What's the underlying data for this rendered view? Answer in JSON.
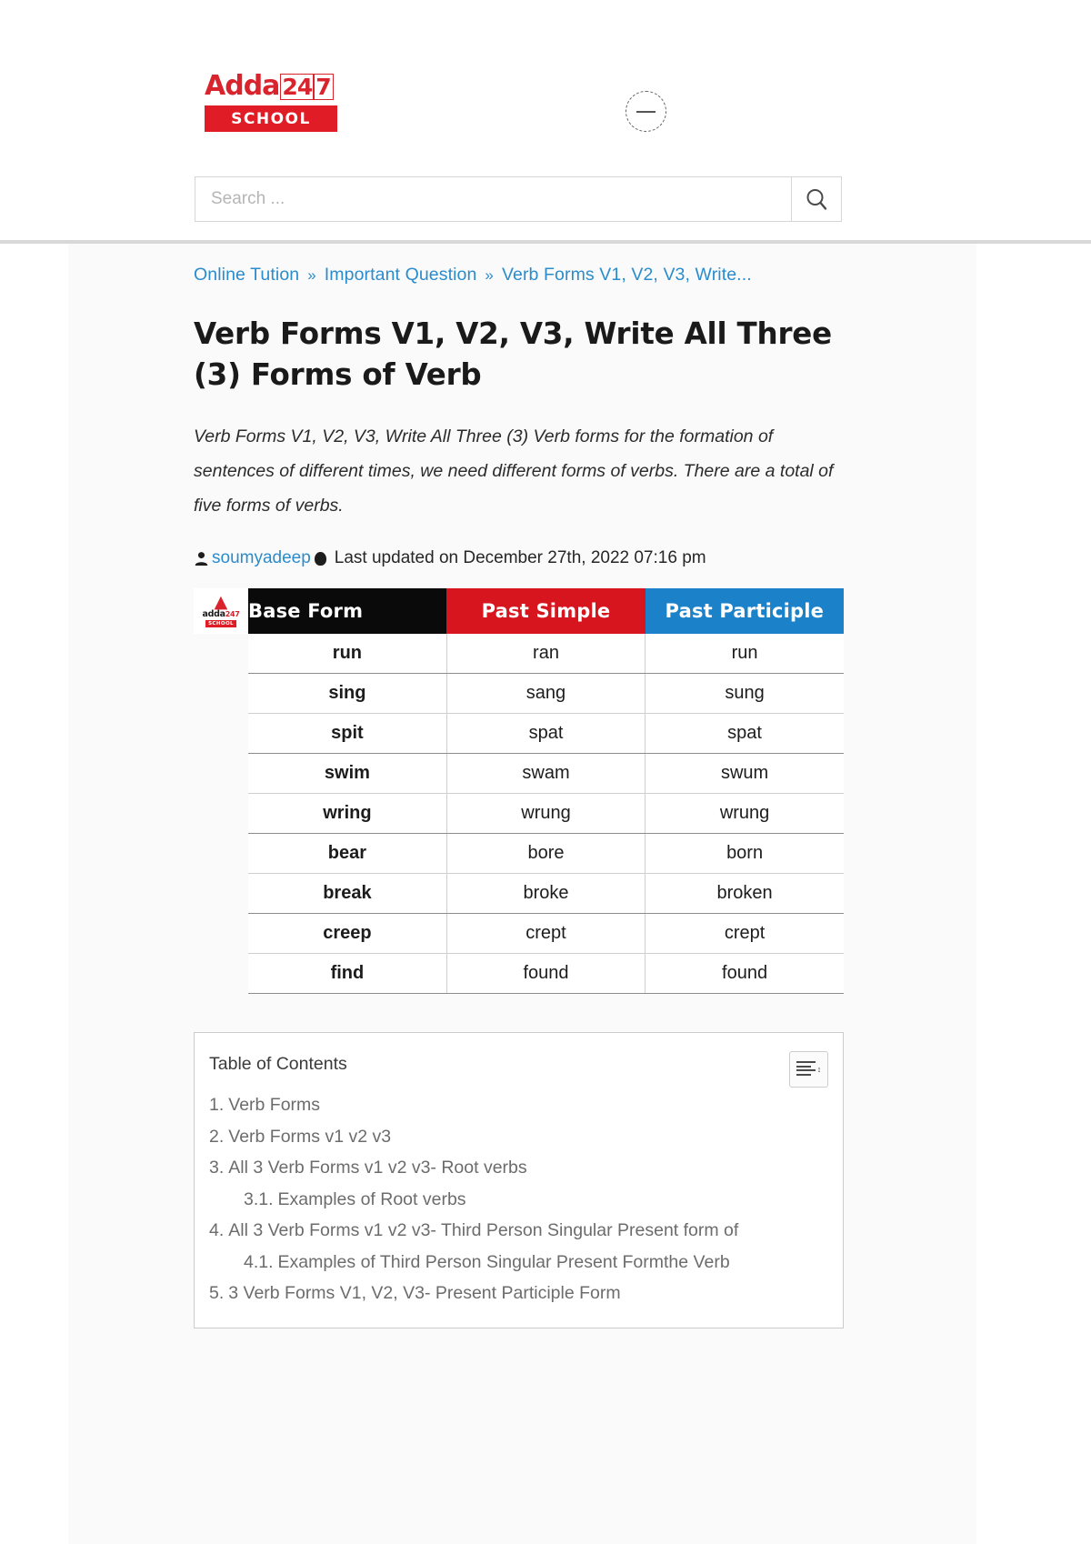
{
  "header": {
    "logo": {
      "word": "Adda",
      "num_a": "24",
      "num_b": "7",
      "sub": "SCHOOL"
    },
    "menu_icon": "minus-circle-icon",
    "search": {
      "placeholder": "Search ...",
      "value": "",
      "button_icon": "search-icon"
    }
  },
  "breadcrumb": {
    "items": [
      {
        "label": "Online Tution"
      },
      {
        "label": "Important Question"
      },
      {
        "label": "Verb Forms V1, V2, V3, Write..."
      }
    ],
    "separator": "»"
  },
  "post": {
    "title": "Verb Forms V1, V2, V3, Write All Three (3) Forms of Verb",
    "excerpt": "Verb Forms V1, V2, V3, Write All Three (3) Verb forms for the formation of sentences of different times, we need different forms of verbs. There are a total of five forms of verbs.",
    "author": "soumyadeep",
    "updated": "Last updated on December 27th, 2022 07:16 pm"
  },
  "verb_table": {
    "mini_logo": {
      "word": "adda",
      "num": "247",
      "sub": "SCHOOL"
    },
    "headers": [
      "Base Form",
      "Past Simple",
      "Past Participle"
    ],
    "header_colors": {
      "base": "#0a0a0a",
      "past_simple": "#d6151e",
      "past_participle": "#1b81c8"
    },
    "rows": [
      [
        "run",
        "ran",
        "run"
      ],
      [
        "sing",
        "sang",
        "sung"
      ],
      [
        "spit",
        "spat",
        "spat"
      ],
      [
        "swim",
        "swam",
        "swum"
      ],
      [
        "wring",
        "wrung",
        "wrung"
      ],
      [
        "bear",
        "bore",
        "born"
      ],
      [
        "break",
        "broke",
        "broken"
      ],
      [
        "creep",
        "crept",
        "crept"
      ],
      [
        "find",
        "found",
        "found"
      ]
    ]
  },
  "toc": {
    "title": "Table of Contents",
    "toggle_icon": "list-toggle-icon",
    "items": [
      {
        "num": "1.",
        "label": "Verb Forms",
        "level": 1
      },
      {
        "num": "2.",
        "label": "Verb Forms v1 v2 v3",
        "level": 1
      },
      {
        "num": "3.",
        "label": "All 3 Verb Forms v1 v2 v3- Root verbs",
        "level": 1
      },
      {
        "num": "3.1.",
        "label": "Examples of Root verbs",
        "level": 2
      },
      {
        "num": "4.",
        "label": "All 3 Verb Forms v1 v2 v3- Third Person Singular Present form of",
        "level": 1
      },
      {
        "num": "4.1.",
        "label": "Examples of Third Person Singular Present Formthe Verb",
        "level": 2
      },
      {
        "num": "5.",
        "label": "3 Verb Forms V1, V2, V3- Present Participle Form",
        "level": 1
      }
    ]
  }
}
